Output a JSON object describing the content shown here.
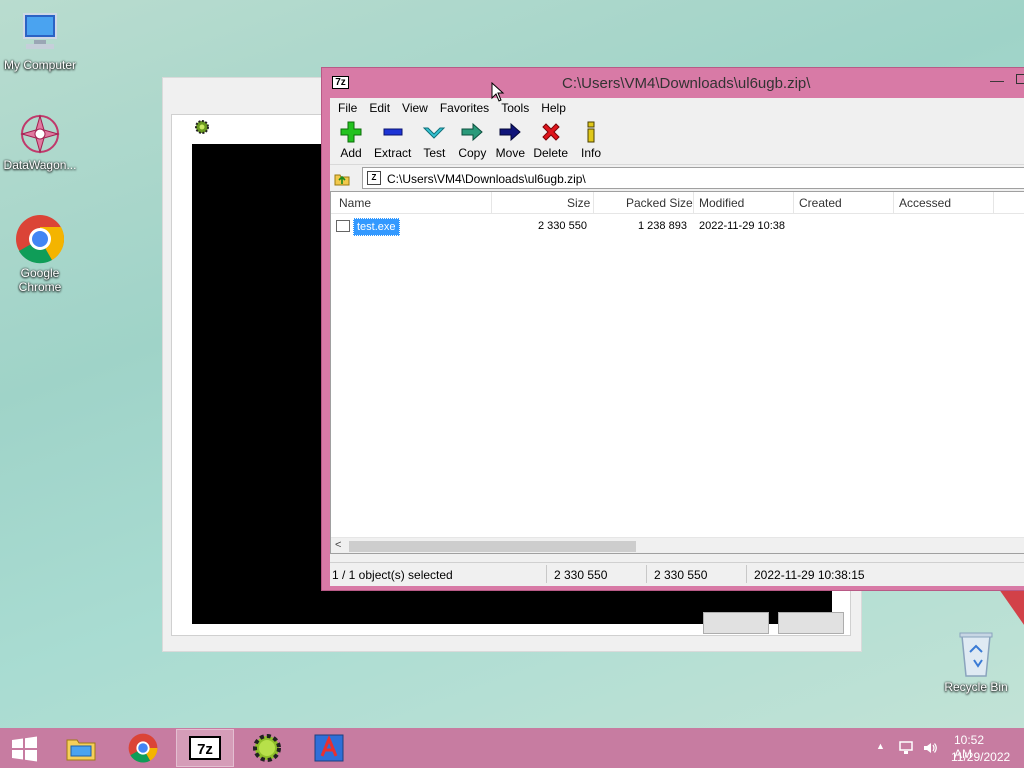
{
  "desktop": {
    "icons": [
      {
        "label": "My Computer",
        "icon": "computer-icon"
      },
      {
        "label": "DataWagon...",
        "icon": "datawagon-icon"
      },
      {
        "label": "Google Chrome",
        "icon": "chrome-icon"
      },
      {
        "label": "Recycle Bin",
        "icon": "recycle-bin-icon"
      }
    ]
  },
  "window": {
    "title": "C:\\Users\\VM4\\Downloads\\ul6ugb.zip\\",
    "app_icon_text": "7z",
    "menu": [
      "File",
      "Edit",
      "View",
      "Favorites",
      "Tools",
      "Help"
    ],
    "toolbar": [
      "Add",
      "Extract",
      "Test",
      "Copy",
      "Move",
      "Delete",
      "Info"
    ],
    "address": "C:\\Users\\VM4\\Downloads\\ul6ugb.zip\\",
    "columns": [
      "Name",
      "Size",
      "Packed Size",
      "Modified",
      "Created",
      "Accessed"
    ],
    "files": [
      {
        "name": "test.exe",
        "size": "2 330 550",
        "packed": "1 238 893",
        "modified": "2022-11-29 10:38",
        "created": "",
        "accessed": ""
      }
    ],
    "status": {
      "selected": "1 / 1 object(s) selected",
      "size": "2 330 550",
      "packed": "2 330 550",
      "modified": "2022-11-29 10:38:15"
    }
  },
  "taskbar": {
    "apps": [
      "file-explorer-icon",
      "chrome-icon",
      "7zip-icon",
      "gear-app-icon",
      "font-app-icon"
    ],
    "time": "10:52 AM",
    "date": "11/29/2022"
  },
  "colors": {
    "window_frame": "#d87aa6",
    "taskbar": "#c77ca1",
    "selection": "#3399ff"
  }
}
